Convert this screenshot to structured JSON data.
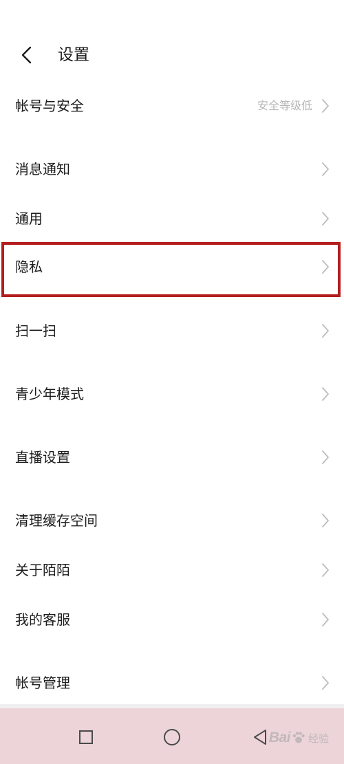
{
  "header": {
    "title": "设置"
  },
  "settings": {
    "account_security": {
      "label": "帐号与安全",
      "value": "安全等级低"
    },
    "notifications": {
      "label": "消息通知"
    },
    "general": {
      "label": "通用"
    },
    "privacy": {
      "label": "隐私"
    },
    "scan": {
      "label": "扫一扫"
    },
    "youth_mode": {
      "label": "青少年模式"
    },
    "live_settings": {
      "label": "直播设置"
    },
    "clear_cache": {
      "label": "清理缓存空间"
    },
    "about": {
      "label": "关于陌陌"
    },
    "customer_service": {
      "label": "我的客服"
    },
    "account_management": {
      "label": "帐号管理"
    }
  },
  "highlight": {
    "target": "privacy",
    "color": "#b41d1d"
  },
  "watermark": {
    "text": "Bai",
    "suffix": "经验"
  },
  "colors": {
    "navbar": "#ecd4d8",
    "secondary_text": "#b7b7b7",
    "chevron": "#bdbdbd"
  }
}
